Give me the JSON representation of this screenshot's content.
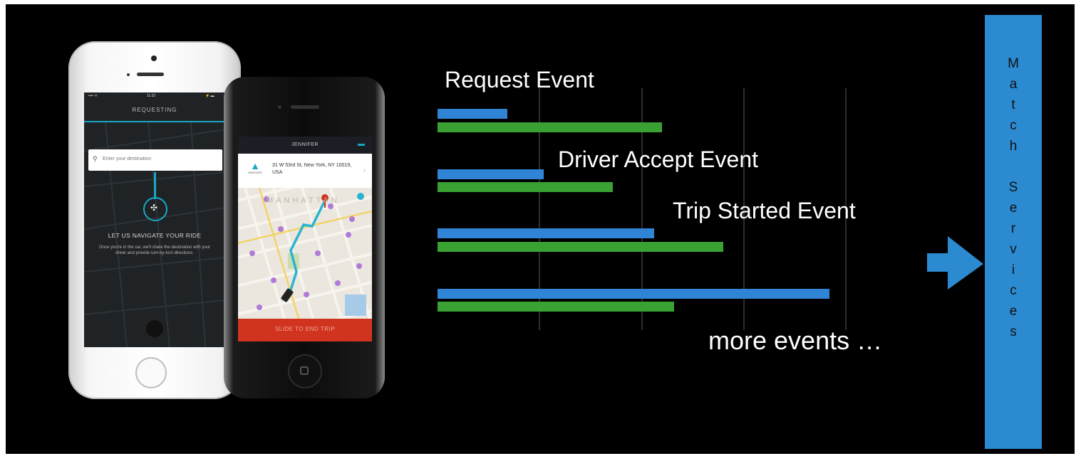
{
  "phone_white": {
    "status_left": "•••• ᯤ",
    "status_time": "11:22",
    "status_right": "⚡ ▬",
    "title": "REQUESTING",
    "destination_placeholder": "Enter your destination",
    "heading": "LET US NAVIGATE YOUR RIDE",
    "description": "Once you're in the car, we'll share the destination with your driver and provide turn-by-turn directions."
  },
  "phone_black": {
    "header_title": "JENNIFER",
    "navigate_label": "NAVIGATE",
    "address": "31 W 53rd St, New York, NY 10019, USA",
    "map_label": "MANHATTAN",
    "end_trip_button": "SLIDE TO END TRIP"
  },
  "events": {
    "request": "Request Event",
    "driver_accept": "Driver Accept Event",
    "trip_started": "Trip Started Event",
    "more": "more events …"
  },
  "match_services_letters": [
    "M",
    "a",
    "t",
    "c",
    "h",
    "",
    "S",
    "e",
    "r",
    "v",
    "i",
    "c",
    "e",
    "s"
  ],
  "colors": {
    "background": "#000000",
    "blue_bar": "#2f84d6",
    "green_bar": "#3aa233",
    "match_box": "#2b8ad0",
    "accent_teal": "#19a8c3",
    "end_trip_red": "#d0341f"
  },
  "icons": {
    "search": "search-icon",
    "target": "target-icon",
    "navigate": "navigate-arrow-icon",
    "pin": "map-pin-icon",
    "car": "car-icon",
    "arrow": "right-arrow-icon"
  }
}
